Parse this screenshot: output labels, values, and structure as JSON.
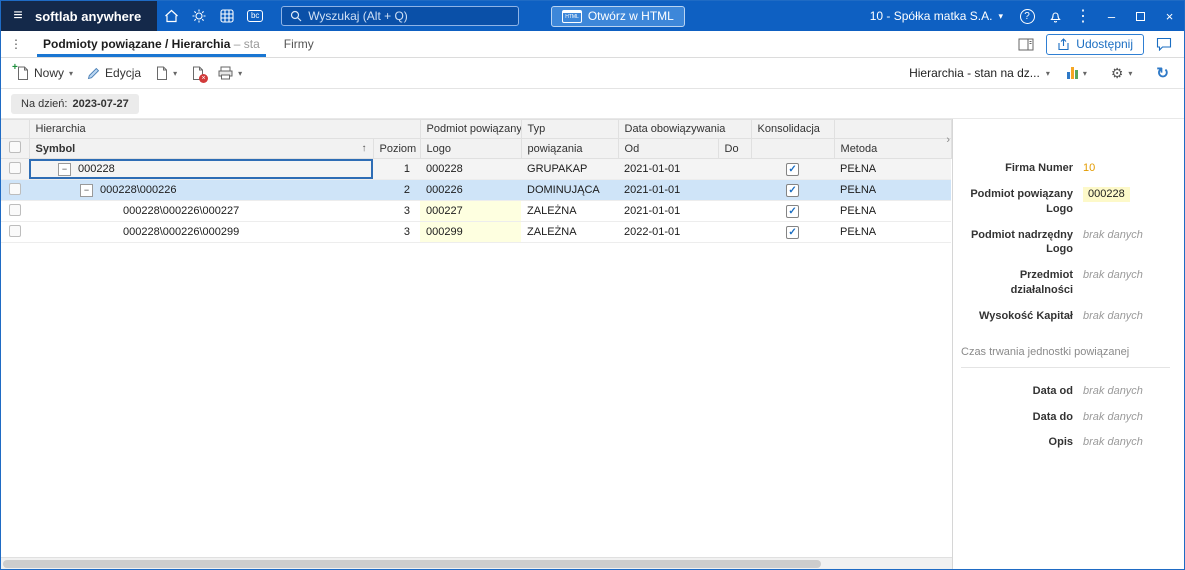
{
  "titlebar": {
    "brand": "softlab anywhere",
    "bc_badge": "bc",
    "search_placeholder": "Wyszukaj (Alt + Q)",
    "open_html_label": "Otwórz w HTML",
    "html_badge": "HTML",
    "company": "10 - Spółka matka S.A."
  },
  "tabbar": {
    "tabs": [
      {
        "label": "Podmioty powiązane / Hierarchia",
        "suffix": " – sta"
      },
      {
        "label": "Firmy",
        "suffix": ""
      }
    ],
    "share_label": "Udostępnij"
  },
  "toolbar": {
    "new_label": "Nowy",
    "edit_label": "Edycja",
    "view_selector": "Hierarchia - stan na dz..."
  },
  "filterbar": {
    "label": "Na dzień:",
    "value": "2023-07-27"
  },
  "table": {
    "group_headers": {
      "hierarchia": "Hierarchia",
      "podmiot_powiazany": "Podmiot powiązany",
      "typ": "Typ",
      "data_obowiazywania": "Data obowiązywania",
      "konsolidacja": "Konsolidacja"
    },
    "columns": {
      "symbol": "Symbol",
      "poziom": "Poziom",
      "logo": "Logo",
      "powiazania": "powiązania",
      "od": "Od",
      "do": "Do",
      "metoda": "Metoda"
    },
    "rows": [
      {
        "symbol": "000228",
        "poziom": "1",
        "logo": "000228",
        "typ_powiazania": "GRUPAKAP",
        "od": "2021-01-01",
        "do": "",
        "metoda": "PEŁNA"
      },
      {
        "symbol": "000228\\000226",
        "poziom": "2",
        "logo": "000226",
        "typ_powiazania": "DOMINUJĄCA",
        "od": "2021-01-01",
        "do": "",
        "metoda": "PEŁNA"
      },
      {
        "symbol": "000228\\000226\\000227",
        "poziom": "3",
        "logo": "000227",
        "typ_powiazania": "ZALEŻNA",
        "od": "2021-01-01",
        "do": "",
        "metoda": "PEŁNA"
      },
      {
        "symbol": "000228\\000226\\000299",
        "poziom": "3",
        "logo": "000299",
        "typ_powiazania": "ZALEŻNA",
        "od": "2022-01-01",
        "do": "",
        "metoda": "PEŁNA"
      }
    ]
  },
  "details": {
    "fields": [
      {
        "label": "Firma Numer",
        "value": "10"
      },
      {
        "label": "Podmiot powiązany Logo",
        "value": "000228"
      },
      {
        "label": "Podmiot nadrzędny Logo",
        "value": "brak danych"
      },
      {
        "label": "Przedmiot działalności",
        "value": "brak danych"
      },
      {
        "label": "Wysokość Kapitał",
        "value": "brak danych"
      }
    ],
    "section_title": "Czas trwania jednostki powiązanej",
    "section_fields": [
      {
        "label": "Data od",
        "value": "brak danych"
      },
      {
        "label": "Data do",
        "value": "brak danych"
      },
      {
        "label": "Opis",
        "value": "brak danych"
      }
    ]
  },
  "colors": {
    "titlebar_blue": "#0e60c2",
    "brand_navy": "#14294a",
    "accent_blue": "#1b6ec2",
    "tab_underline": "#1976d2",
    "selected_row": "#cfe4f8",
    "logo_cell": "#feffe0",
    "value_accent": "#e39b00",
    "value_highlight_bg": "#fdf9c9"
  }
}
